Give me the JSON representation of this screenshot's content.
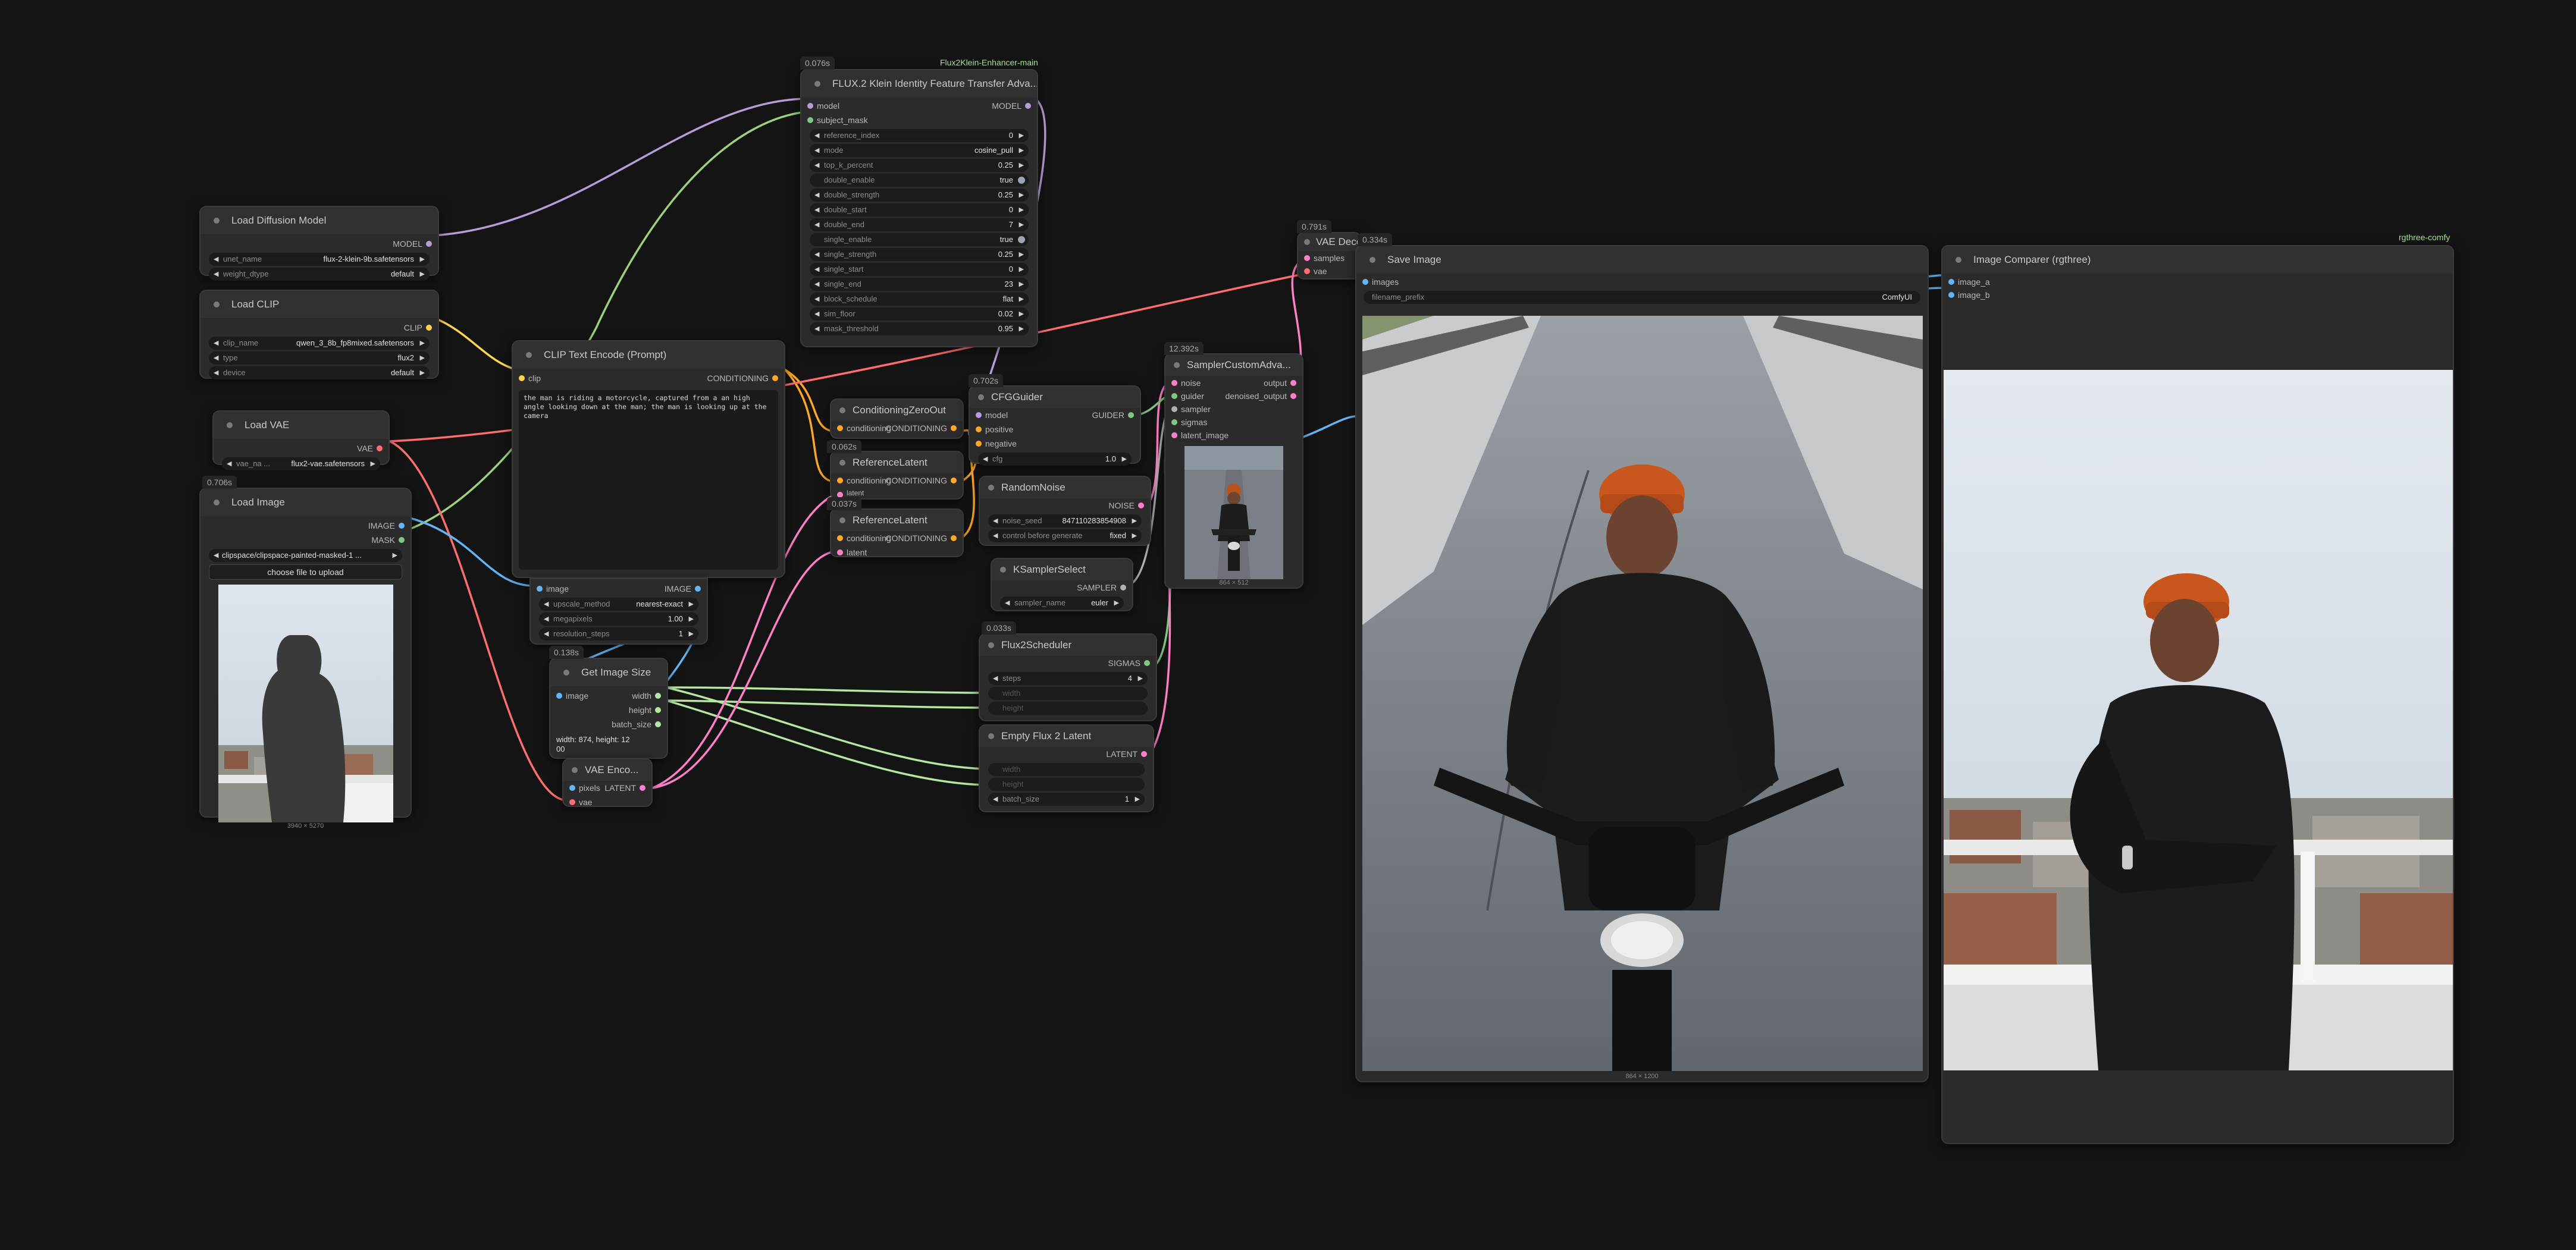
{
  "groups": {
    "group_a": "Flux2Klein-Enhancer-main",
    "group_b": "rgthree-comfy"
  },
  "colors": {
    "canvas": "#141414",
    "node_bg": "#2b2b2b",
    "model_wire": "#b39ddb",
    "clip_wire": "#ffd54f",
    "vae_wire": "#ff6e6e",
    "image_wire": "#64b5f6",
    "cond_wire": "#ffa726",
    "latent_wire": "#ff80c8",
    "mask_wire": "#81c784",
    "int_wire": "#b5e7a0"
  },
  "timings": {
    "flux_transfer": "0.076s",
    "vae_decode": "0.791s",
    "save_image": "0.334s",
    "sampler": "12.392s",
    "cfg_guider": "0.702s",
    "ref_latent_1": "0.062s",
    "ref_latent_2": "0.037s",
    "load_image": "0.706s",
    "get_image_size": "0.138s",
    "flux2_scheduler": "0.033s"
  },
  "load_diffusion": {
    "title": "Load Diffusion Model",
    "out_model": "MODEL",
    "unet_name_label": "unet_name",
    "unet_name_value": "flux-2-klein-9b.safetensors",
    "weight_dtype_label": "weight_dtype",
    "weight_dtype_value": "default"
  },
  "load_clip": {
    "title": "Load CLIP",
    "out_clip": "CLIP",
    "clip_name_label": "clip_name",
    "clip_name_value": "qwen_3_8b_fp8mixed.safetensors",
    "type_label": "type",
    "type_value": "flux2",
    "device_label": "device",
    "device_value": "default"
  },
  "load_vae": {
    "title": "Load VAE",
    "out_vae": "VAE",
    "vae_name_label": "vae_na ...",
    "vae_name_value": "flux2-vae.safetensors"
  },
  "load_image": {
    "title": "Load Image",
    "out_image": "IMAGE",
    "out_mask": "MASK",
    "image_value": "clipspace/clipspace-painted-masked-1 ...",
    "upload_button": "choose file to upload",
    "preview_caption": "3940 × 5270"
  },
  "clip_text": {
    "title": "CLIP Text Encode (Prompt)",
    "in_clip": "clip",
    "out_conditioning": "CONDITIONING",
    "prompt": "the man is riding a motorcycle, captured from a an high angle looking down at the man; the man is looking up at the camera"
  },
  "scale_image": {
    "in_image": "image",
    "out_image": "IMAGE",
    "upscale_label": "upscale_method",
    "upscale_value": "nearest-exact",
    "megapixels_label": "megapixels",
    "megapixels_value": "1.00",
    "resolution_label": "resolution_steps",
    "resolution_value": "1"
  },
  "get_image_size": {
    "title": "Get Image Size",
    "in_image": "image",
    "out_width": "width",
    "out_height": "height",
    "out_batch": "batch_size",
    "readout": "width: 874, height: 12\n00"
  },
  "vae_encode": {
    "title": "VAE Enco...",
    "in_pixels": "pixels",
    "in_vae": "vae",
    "out_latent": "LATENT"
  },
  "flux_transfer": {
    "title": "FLUX.2 Klein Identity Feature Transfer Adva...",
    "in_model": "model",
    "in_subject_mask": "subject_mask",
    "out_model": "MODEL",
    "widgets": [
      {
        "label": "reference_index",
        "value": "0"
      },
      {
        "label": "mode",
        "value": "cosine_pull"
      },
      {
        "label": "top_k_percent",
        "value": "0.25"
      },
      {
        "label": "double_enable",
        "value": "true"
      },
      {
        "label": "double_strength",
        "value": "0.25"
      },
      {
        "label": "double_start",
        "value": "0"
      },
      {
        "label": "double_end",
        "value": "7"
      },
      {
        "label": "single_enable",
        "value": "true"
      },
      {
        "label": "single_strength",
        "value": "0.25"
      },
      {
        "label": "single_start",
        "value": "0"
      },
      {
        "label": "single_end",
        "value": "23"
      },
      {
        "label": "block_schedule",
        "value": "flat"
      },
      {
        "label": "sim_floor",
        "value": "0.02"
      },
      {
        "label": "mask_threshold",
        "value": "0.95"
      }
    ]
  },
  "cond_zero": {
    "title": "ConditioningZeroOut",
    "in_conditioning": "conditioning",
    "out_conditioning": "CONDITIONING"
  },
  "ref_latent_1": {
    "title": "ReferenceLatent",
    "in_conditioning": "conditioning",
    "in_latent": "latent",
    "out_conditioning": "CONDITIONING"
  },
  "ref_latent_2": {
    "title": "ReferenceLatent",
    "in_conditioning": "conditioning",
    "in_latent": "latent",
    "out_conditioning": "CONDITIONING"
  },
  "cfg_guider": {
    "title": "CFGGuider",
    "in_model": "model",
    "in_positive": "positive",
    "in_negative": "negative",
    "out_guider": "GUIDER",
    "cfg_label": "cfg",
    "cfg_value": "1.0"
  },
  "random_noise": {
    "title": "RandomNoise",
    "out_noise": "NOISE",
    "seed_label": "noise_seed",
    "seed_value": "847110283854908",
    "control_label": "control before generate",
    "control_value": "fixed"
  },
  "ksampler_select": {
    "title": "KSamplerSelect",
    "out_sampler": "SAMPLER",
    "sampler_label": "sampler_name",
    "sampler_value": "euler"
  },
  "flux2_scheduler": {
    "title": "Flux2Scheduler",
    "out_sigmas": "SIGMAS",
    "steps_label": "steps",
    "steps_value": "4",
    "width_label": "width",
    "height_label": "height"
  },
  "empty_latent": {
    "title": "Empty Flux 2 Latent",
    "out_latent": "LATENT",
    "width_label": "width",
    "height_label": "height",
    "batch_label": "batch_size",
    "batch_value": "1"
  },
  "sampler_custom": {
    "title": "SamplerCustomAdva...",
    "in_noise": "noise",
    "in_guider": "guider",
    "in_sampler": "sampler",
    "in_sigmas": "sigmas",
    "in_latent": "latent_image",
    "out_output": "output",
    "out_denoised": "denoised_output",
    "preview_caption": "864 × 512"
  },
  "vae_decode": {
    "title": "VAE Deco...",
    "in_samples": "samples",
    "in_vae": "vae"
  },
  "save_image": {
    "title": "Save Image",
    "in_images": "images",
    "prefix_label": "filename_prefix",
    "prefix_value": "ComfyUI",
    "preview_caption": "864 × 1200"
  },
  "image_comparer": {
    "title": "Image Comparer (rgthree)",
    "in_image_a": "image_a",
    "in_image_b": "image_b"
  }
}
